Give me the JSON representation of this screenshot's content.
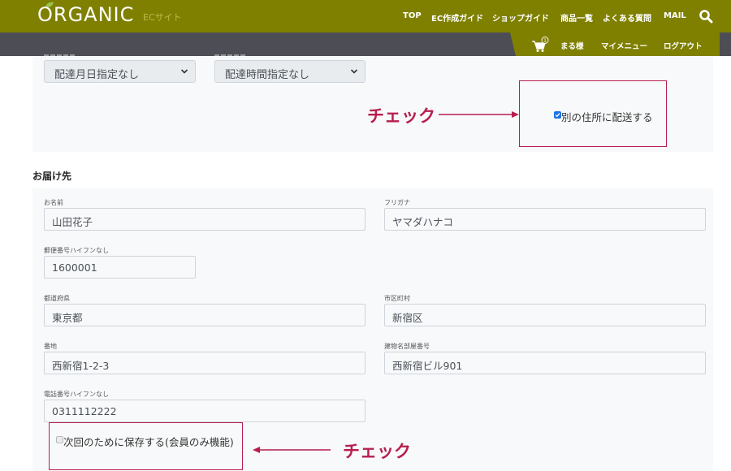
{
  "header": {
    "logo": "ORGANIC",
    "logo_sub": "ECサイト",
    "nav": [
      "TOP",
      "EC作成ガイド",
      "ショップガイド",
      "商品一覧",
      "よくある質問",
      "MAIL"
    ],
    "cart_count": "1",
    "sub_nav": [
      "まる様",
      "マイメニュー",
      "ログアウト"
    ]
  },
  "delivery": {
    "date_select": "配達月日指定なし",
    "time_select": "配達時間指定なし",
    "ship_other_label": "別の住所に配送する",
    "ship_other_checked": true
  },
  "recipient": {
    "title": "お届け先",
    "fields": {
      "name": {
        "label": "お名前",
        "value": "山田花子"
      },
      "kana": {
        "label": "フリガナ",
        "value": "ヤマダハナコ"
      },
      "zip": {
        "label": "郵便番号ハイフンなし",
        "value": "1600001"
      },
      "pref": {
        "label": "都道府県",
        "value": "東京都"
      },
      "city": {
        "label": "市区町村",
        "value": "新宿区"
      },
      "street": {
        "label": "番地",
        "value": "西新宿1-2-3"
      },
      "building": {
        "label": "建物名部屋番号",
        "value": "西新宿ビル901"
      },
      "phone": {
        "label": "電話番号ハイフンなし",
        "value": "0311112222"
      }
    },
    "save_label": "次回のために保存する(会員のみ機能)"
  },
  "annotations": {
    "check_1": "チェック",
    "check_2": "チェック"
  },
  "colors": {
    "header_olive": "#7f8000",
    "subbar_gray": "#4d4e55",
    "annotation": "#b71e4e"
  }
}
